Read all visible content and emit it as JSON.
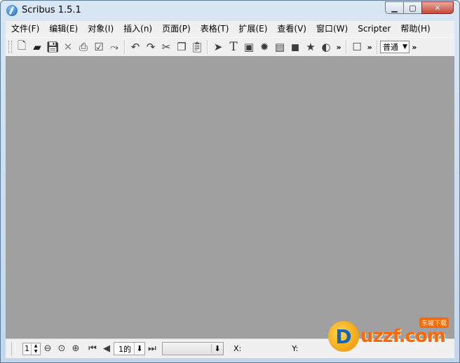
{
  "window": {
    "title": "Scribus 1.5.1"
  },
  "menubar": [
    {
      "id": "file",
      "label": "文件(F)"
    },
    {
      "id": "edit",
      "label": "编辑(E)"
    },
    {
      "id": "object",
      "label": "对象(I)"
    },
    {
      "id": "insert",
      "label": "插入(n)"
    },
    {
      "id": "page",
      "label": "页面(P)"
    },
    {
      "id": "table",
      "label": "表格(T)"
    },
    {
      "id": "extras",
      "label": "扩展(E)"
    },
    {
      "id": "view",
      "label": "查看(V)"
    },
    {
      "id": "windows",
      "label": "窗口(W)"
    },
    {
      "id": "scripter",
      "label": "Scripter"
    },
    {
      "id": "help",
      "label": "帮助(H)"
    }
  ],
  "toolbar": {
    "more_glyph": "»",
    "mode_select": {
      "value": "普通"
    }
  },
  "statusbar": {
    "zoom_value": "1",
    "page_value": "1的",
    "x_label": "X:",
    "y_label": "Y:"
  },
  "watermark": {
    "brand": "uzzf.com",
    "sub": "东坡下载"
  }
}
